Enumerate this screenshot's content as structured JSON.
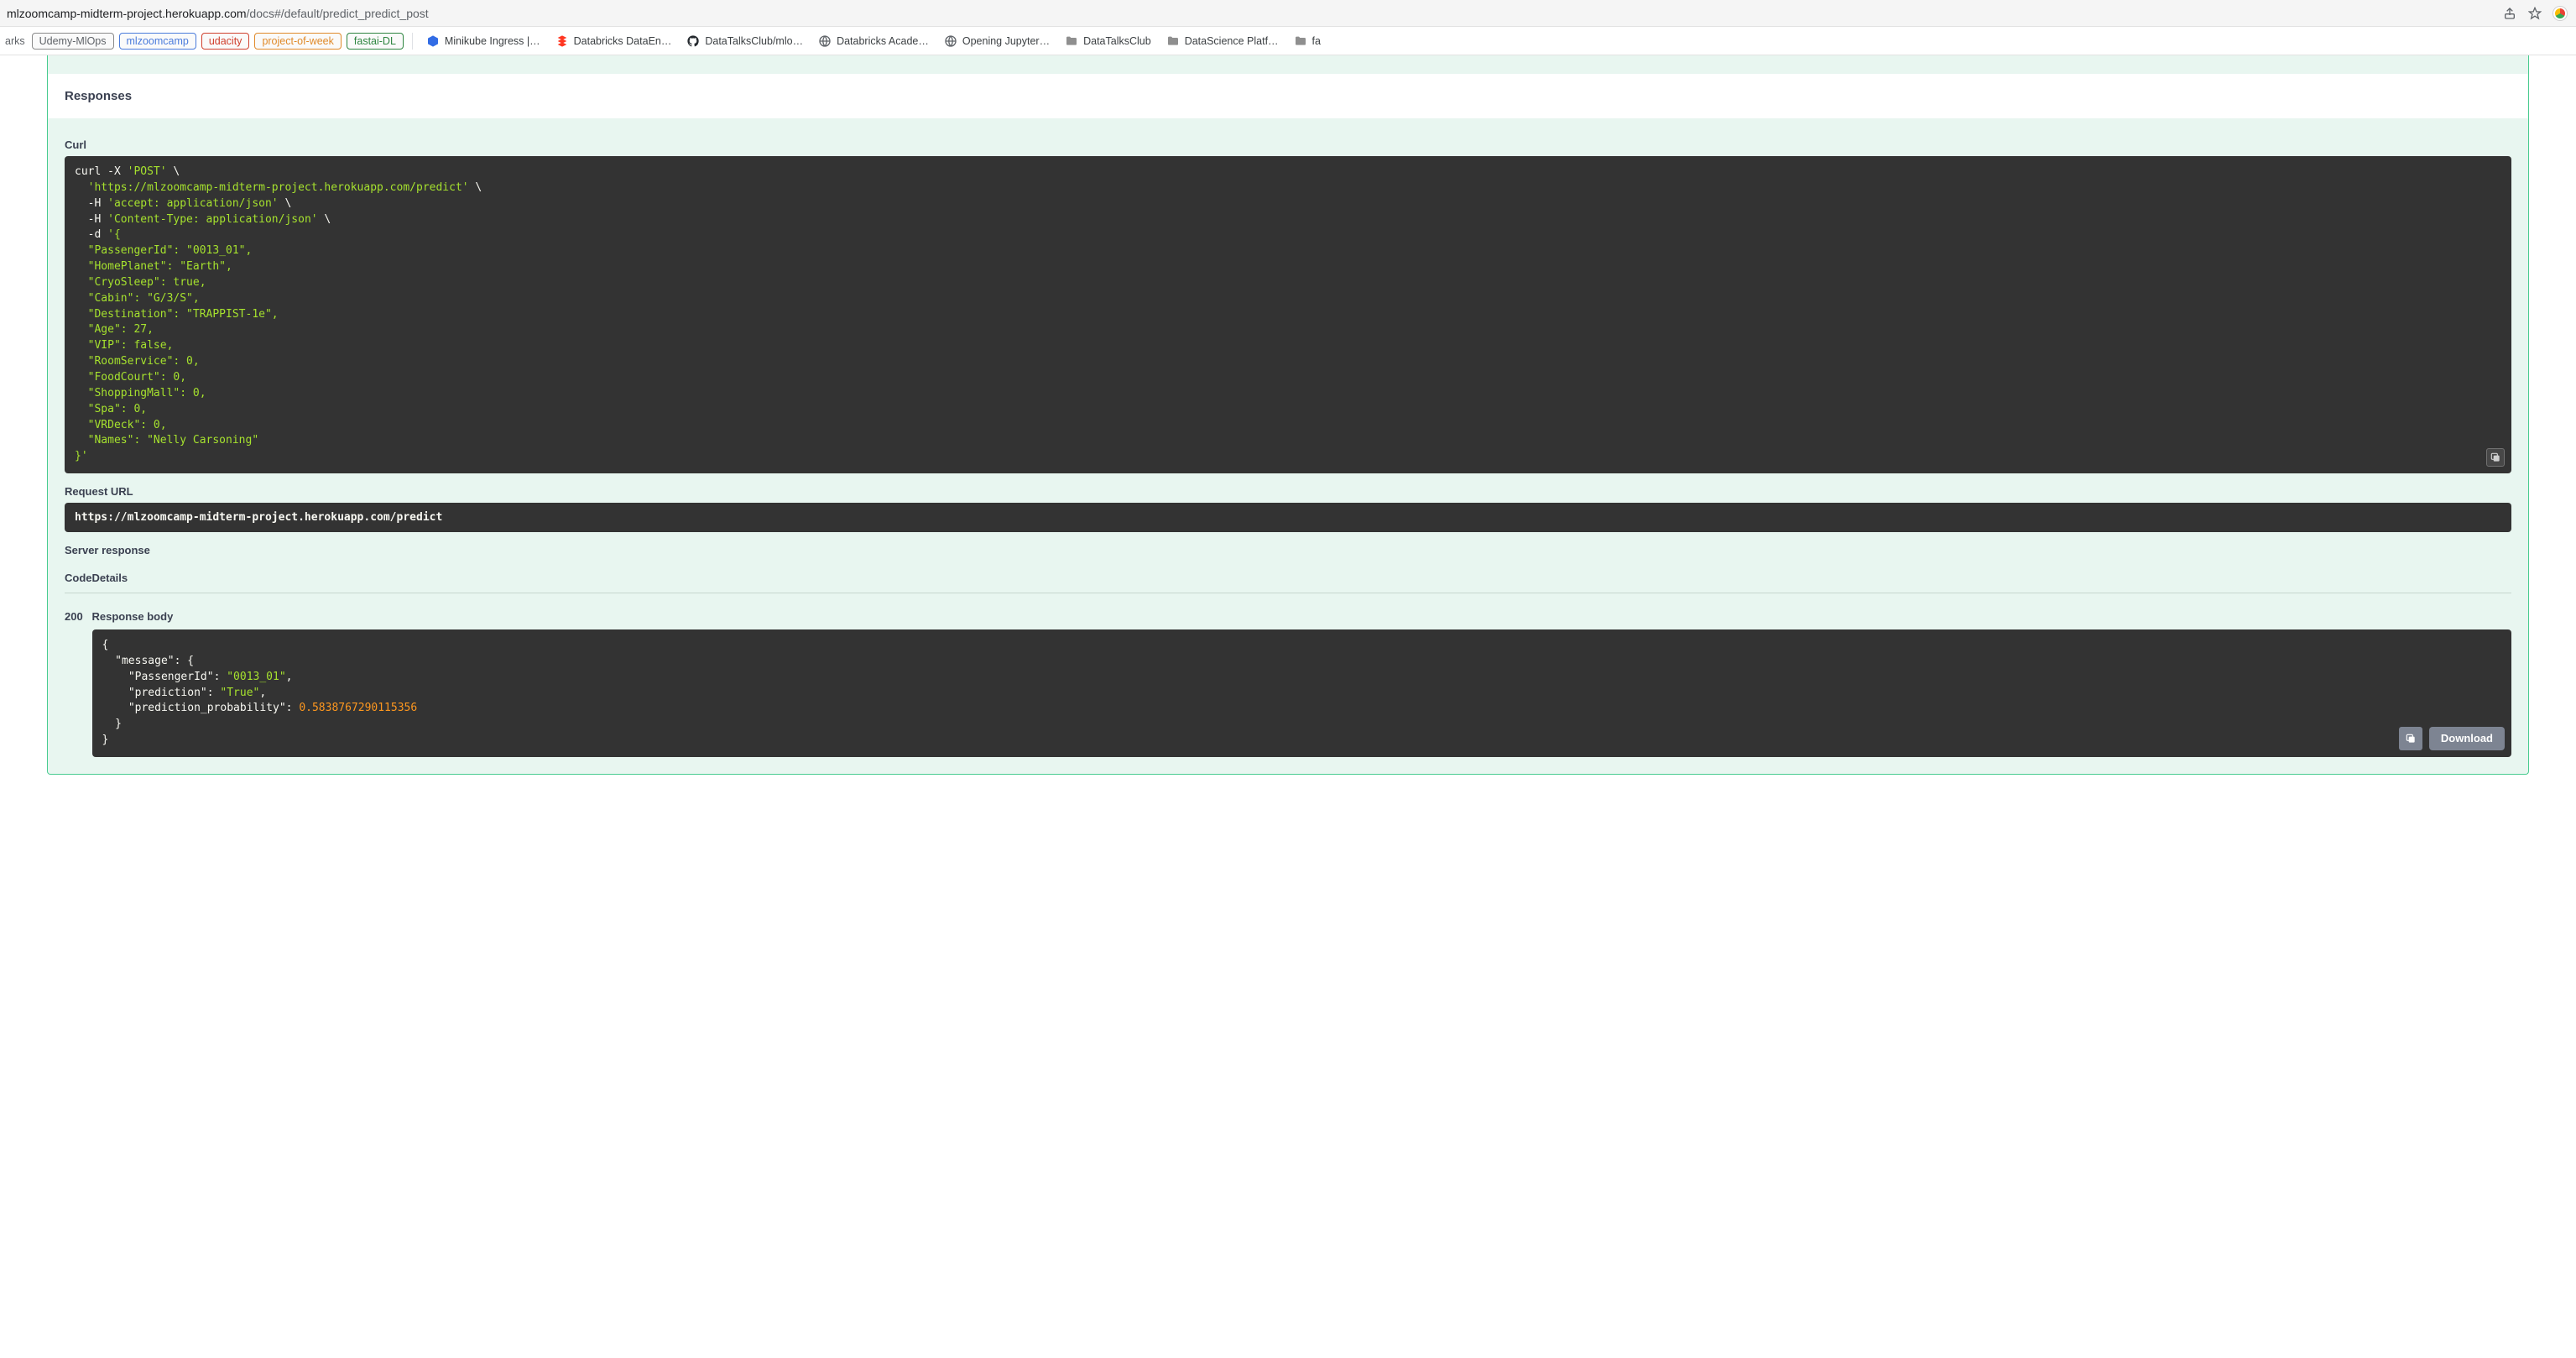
{
  "browser": {
    "url_host": "mlzoomcamp-midterm-project.herokuapp.com",
    "url_path": "/docs#/default/predict_predict_post"
  },
  "bookmarks": {
    "prefix": "arks",
    "tags": [
      {
        "label": "Udemy-MlOps",
        "style": "gray"
      },
      {
        "label": "mlzoomcamp",
        "style": "blue"
      },
      {
        "label": "udacity",
        "style": "red"
      },
      {
        "label": "project-of-week",
        "style": "orange"
      },
      {
        "label": "fastai-DL",
        "style": "green"
      }
    ],
    "items": [
      {
        "label": "Minikube Ingress |…",
        "icon": "k8s"
      },
      {
        "label": "Databricks DataEn…",
        "icon": "db"
      },
      {
        "label": "DataTalksClub/mlo…",
        "icon": "gh"
      },
      {
        "label": "Databricks Acade…",
        "icon": "globe"
      },
      {
        "label": "Opening Jupyter…",
        "icon": "globe"
      },
      {
        "label": "DataTalksClub",
        "icon": "folder"
      },
      {
        "label": "DataScience Platf…",
        "icon": "folder"
      },
      {
        "label": "fa",
        "icon": "folder"
      }
    ]
  },
  "swagger": {
    "responses_header": "Responses",
    "curl_label": "Curl",
    "request_url_label": "Request URL",
    "server_response_label": "Server response",
    "code_header": "Code",
    "details_header": "Details",
    "response_body_label": "Response body",
    "download_label": "Download",
    "request_url": "https://mlzoomcamp-midterm-project.herokuapp.com/predict",
    "curl": {
      "c1": "curl",
      "c2": " -X ",
      "m": "'POST'",
      "bs": " \\",
      "url": "  'https://mlzoomcamp-midterm-project.herokuapp.com/predict'",
      "h1": "  -H ",
      "h1v": "'accept: application/json'",
      "h2": "  -H ",
      "h2v": "'Content-Type: application/json'",
      "d": "  -d ",
      "dv": "'{",
      "l1": "  \"PassengerId\": \"0013_01\",",
      "l2": "  \"HomePlanet\": \"Earth\",",
      "l3": "  \"CryoSleep\": true,",
      "l4": "  \"Cabin\": \"G/3/S\",",
      "l5": "  \"Destination\": \"TRAPPIST-1e\",",
      "l6": "  \"Age\": 27,",
      "l7": "  \"VIP\": false,",
      "l8": "  \"RoomService\": 0,",
      "l9": "  \"FoodCourt\": 0,",
      "l10": "  \"ShoppingMall\": 0,",
      "l11": "  \"Spa\": 0,",
      "l12": "  \"VRDeck\": 0,",
      "l13": "  \"Names\": \"Nelly Carsoning\"",
      "end": "}'"
    },
    "response": {
      "code": "200",
      "body": {
        "l1": "{",
        "l2a": "  ",
        "l2b": "\"message\"",
        "l2c": ": {",
        "l3b": "\"PassengerId\"",
        "l3v": "\"0013_01\"",
        "l4b": "\"prediction\"",
        "l4v": "\"True\"",
        "l5b": "\"prediction_probability\"",
        "l5v": "0.5838767290115356",
        "l6": "  }",
        "l7": "}"
      }
    }
  }
}
